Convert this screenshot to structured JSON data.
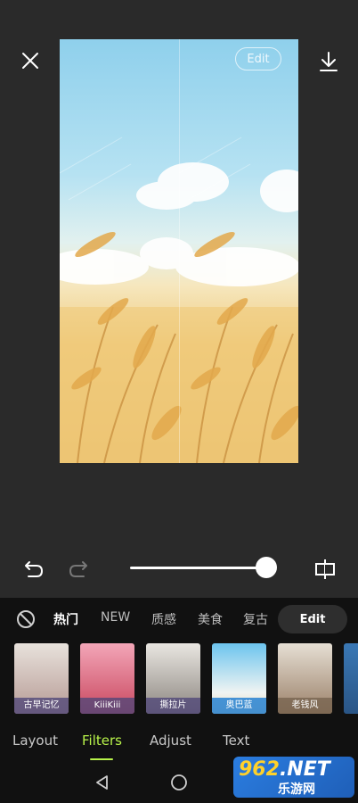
{
  "canvas": {
    "edit_label": "Edit"
  },
  "editor": {
    "intensity": 1.0
  },
  "categories": {
    "items": [
      "热门",
      "NEW",
      "质感",
      "美食",
      "复古"
    ],
    "active": "热门",
    "edit_button": "Edit"
  },
  "filters": [
    {
      "label": "古早记忆",
      "color": "#c9a7a0"
    },
    {
      "label": "KiiiKiii",
      "color": "#d97b8a"
    },
    {
      "label": "撕拉片",
      "color": "#c6c3be"
    },
    {
      "label": "奥巴蓝",
      "color": "#4aa7d6"
    },
    {
      "label": "老钱风",
      "color": "#b8a48f"
    }
  ],
  "tabs": {
    "items": [
      "Layout",
      "Filters",
      "Adjust",
      "Text"
    ],
    "active": "Filters"
  },
  "watermark": {
    "logo_num": "962",
    "logo_suffix": ".NET",
    "sub": "乐游网"
  }
}
